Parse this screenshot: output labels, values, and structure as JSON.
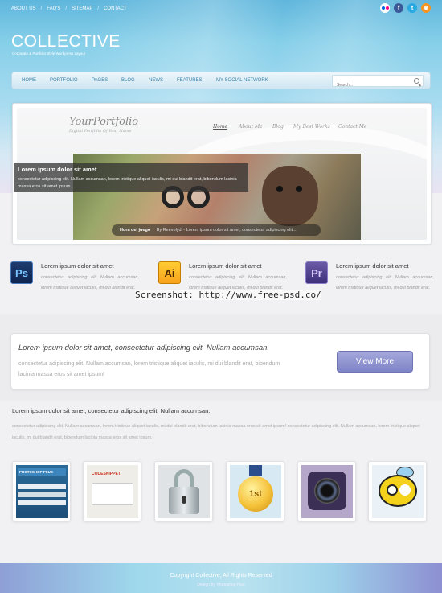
{
  "topnav": {
    "items": [
      "ABOUT US",
      "FAQ'S",
      "SITEMAP",
      "CONTACT"
    ]
  },
  "social": [
    "flickr-icon",
    "facebook-icon",
    "twitter-icon",
    "rss-icon"
  ],
  "brand": {
    "logo": "COLLECTIVE",
    "tagline": "Corporate & Portfolio Style Wordpress Layout"
  },
  "nav": {
    "items": [
      "HOME",
      "PORTFOLIO",
      "PAGES",
      "BLOG",
      "NEWS",
      "FEATURES",
      "MY SOCIAL NETWORK"
    ],
    "search_placeholder": "Search..."
  },
  "portfolio": {
    "logo": "YourPortfolio",
    "subtitle": "Digital Portfolio Of Your Name",
    "nav": [
      "Home",
      "About Me",
      "Blog",
      "My Best Works",
      "Contact Me"
    ],
    "hero_caption_title": "Hora del juego",
    "hero_caption_by": "By Reevolydi",
    "hero_caption_text": "Lorem ipsum dolor sit amet, consectetur adipiscing elit..."
  },
  "caption": {
    "title": "Lorem ipsum dolor sit amet",
    "text": "consectetur adipiscing elit. Nullam accumsan, lorem tristique aliquet iaculis, mi dui blandit erat, bibendum lacinia massa eros sit amet ipsum."
  },
  "features": [
    {
      "icon": "Ps",
      "title": "Lorem ipsum dolor sit amet",
      "text": "consectetur adipiscing elit Nullam accumsan, lorem tristique aliquet iaculis, mi dui blandit erat."
    },
    {
      "icon": "Ai",
      "title": "Lorem ipsum dolor sit amet",
      "text": "consectetur adipiscing elit Nullam accumsan, lorem tristique aliquet iaculis, mi dui blandit erat."
    },
    {
      "icon": "Pr",
      "title": "Lorem ipsum dolor sit amet",
      "text": "consectetur adipiscing elit Nullam accumsan, lorem tristique aliquet iaculis, mi dui blandit erat."
    }
  ],
  "watermark": "Screenshot: http://www.free-psd.co/",
  "callout": {
    "title": "Lorem ipsum dolor sit amet, consectetur adipiscing elit. Nullam accumsan.",
    "text": "consectetur adipiscing elit. Nullam accumsan, lorem tristique aliquet iaculis, mi dui blandit erat, bibendum lacinia massa eros sit amet ipsum!",
    "button": "View More"
  },
  "textblock": {
    "title": "Lorem ipsum dolor sit amet, consectetur adipiscing elit. Nullam accumsan.",
    "text": "consectetur adipiscing elit. Nullam accumsan, lorem tristique aliquet iaculis, mi dui blandit erat, bibendum lacinia massa eros sit amet ipsum! consectetur adipiscing elit. Nullam accumsan, lorem tristique aliquet iaculis, mi dui blandit erat, bibendum lacinia massa eros sit amet ipsum."
  },
  "thumbs": {
    "t1_title": "PHOTOSHOP PLUS",
    "t2_title": "CODESNIPPET",
    "t4_label": "1st"
  },
  "footer": {
    "copyright": "Copyright Collective, All Rights Reserved",
    "by": "Design By Photoshop Plus"
  }
}
